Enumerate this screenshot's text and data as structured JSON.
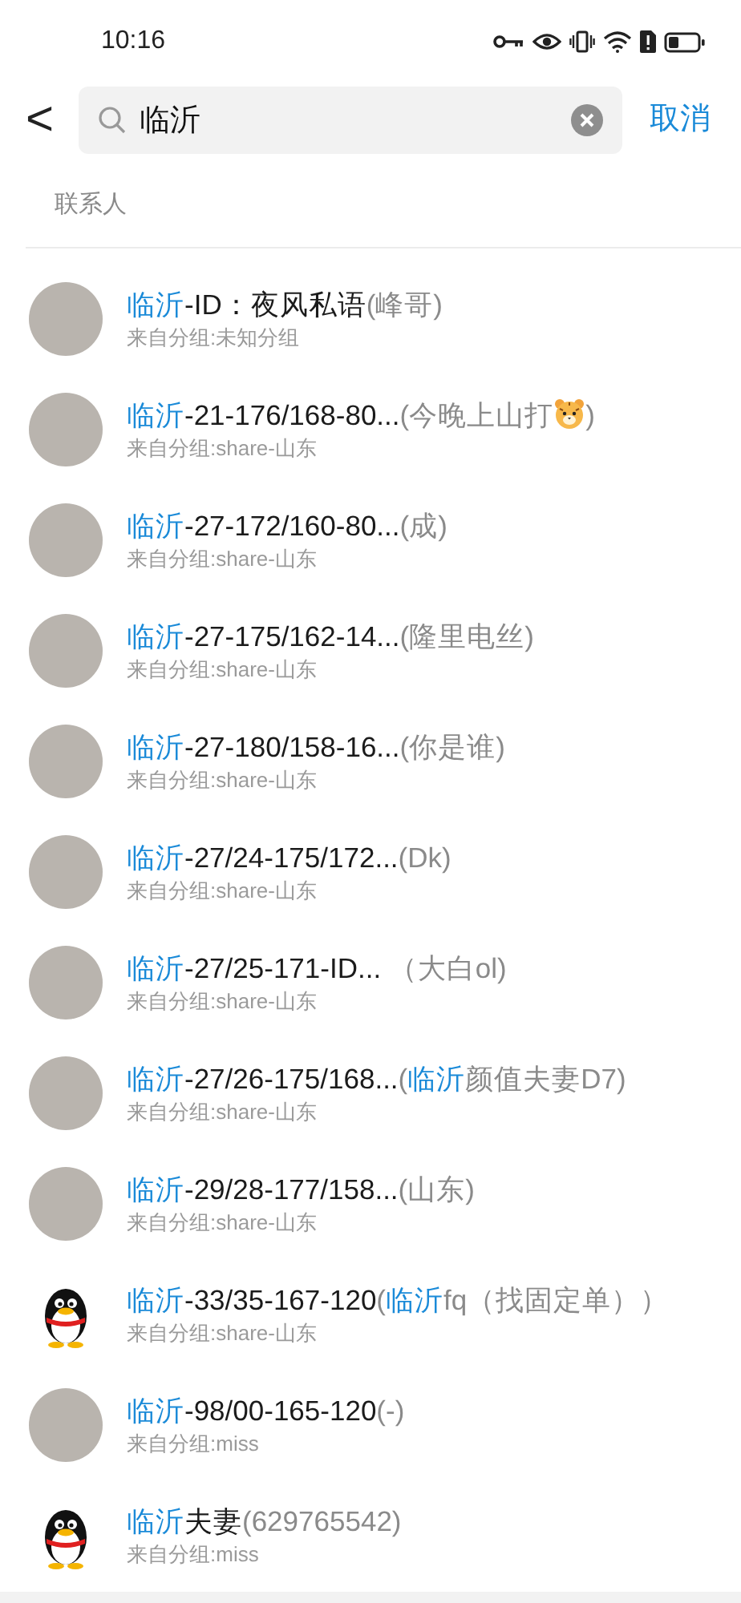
{
  "status_bar": {
    "time": "10:16"
  },
  "search": {
    "back": "<",
    "value": "临沂",
    "cancel": "取消"
  },
  "section": {
    "title": "联系人"
  },
  "contacts": [
    {
      "kind": "photo",
      "parts": [
        {
          "kind": "match",
          "text": "临沂"
        },
        {
          "kind": "name",
          "text": "-ID：夜风私语"
        },
        {
          "kind": "remark",
          "text": "(峰哥)"
        }
      ],
      "group": "来自分组:未知分组"
    },
    {
      "kind": "photo",
      "parts": [
        {
          "kind": "match",
          "text": "临沂"
        },
        {
          "kind": "name",
          "text": "-21-176/168-80..."
        },
        {
          "kind": "remark",
          "text": "(今晚上山打"
        },
        {
          "kind": "tiger"
        },
        {
          "kind": "remark",
          "text": ")"
        }
      ],
      "group": "来自分组:share-山东"
    },
    {
      "kind": "photo",
      "parts": [
        {
          "kind": "match",
          "text": "临沂"
        },
        {
          "kind": "name",
          "text": "-27-172/160-80..."
        },
        {
          "kind": "remark",
          "text": "(成)"
        }
      ],
      "group": "来自分组:share-山东"
    },
    {
      "kind": "photo",
      "parts": [
        {
          "kind": "match",
          "text": "临沂"
        },
        {
          "kind": "name",
          "text": "-27-175/162-14..."
        },
        {
          "kind": "remark",
          "text": "(隆里电丝)"
        }
      ],
      "group": "来自分组:share-山东"
    },
    {
      "kind": "photo",
      "parts": [
        {
          "kind": "match",
          "text": "临沂"
        },
        {
          "kind": "name",
          "text": "-27-180/158-16..."
        },
        {
          "kind": "remark",
          "text": "(你是谁)"
        }
      ],
      "group": "来自分组:share-山东"
    },
    {
      "kind": "photo",
      "parts": [
        {
          "kind": "match",
          "text": "临沂"
        },
        {
          "kind": "name",
          "text": "-27/24-175/172..."
        },
        {
          "kind": "remark",
          "text": "(Dk)"
        }
      ],
      "group": "来自分组:share-山东"
    },
    {
      "kind": "photo",
      "parts": [
        {
          "kind": "match",
          "text": "临沂"
        },
        {
          "kind": "name",
          "text": "-27/25-171-ID..."
        },
        {
          "kind": "remark",
          "text": " （大白ol)"
        }
      ],
      "group": "来自分组:share-山东"
    },
    {
      "kind": "photo",
      "parts": [
        {
          "kind": "match",
          "text": "临沂"
        },
        {
          "kind": "name",
          "text": "-27/26-175/168..."
        },
        {
          "kind": "remark",
          "text": "("
        },
        {
          "kind": "match",
          "text": "临沂"
        },
        {
          "kind": "remark",
          "text": "颜值夫妻D7)"
        }
      ],
      "group": "来自分组:share-山东"
    },
    {
      "kind": "photo",
      "parts": [
        {
          "kind": "match",
          "text": "临沂"
        },
        {
          "kind": "name",
          "text": "-29/28-177/158..."
        },
        {
          "kind": "remark",
          "text": "(山东)"
        }
      ],
      "group": "来自分组:share-山东"
    },
    {
      "kind": "penguin",
      "parts": [
        {
          "kind": "match",
          "text": "临沂"
        },
        {
          "kind": "name",
          "text": "-33/35-167-120"
        },
        {
          "kind": "remark",
          "text": "("
        },
        {
          "kind": "match",
          "text": "临沂"
        },
        {
          "kind": "remark",
          "text": "fq（找固定单））"
        }
      ],
      "group": "来自分组:share-山东"
    },
    {
      "kind": "photo",
      "parts": [
        {
          "kind": "match",
          "text": "临沂"
        },
        {
          "kind": "name",
          "text": "-98/00-165-120"
        },
        {
          "kind": "remark",
          "text": "(-)"
        }
      ],
      "group": "来自分组:miss"
    },
    {
      "kind": "penguin",
      "parts": [
        {
          "kind": "match",
          "text": "临沂"
        },
        {
          "kind": "name",
          "text": "夫妻"
        },
        {
          "kind": "remark",
          "text": "(629765542)"
        }
      ],
      "group": "来自分组:miss"
    }
  ]
}
